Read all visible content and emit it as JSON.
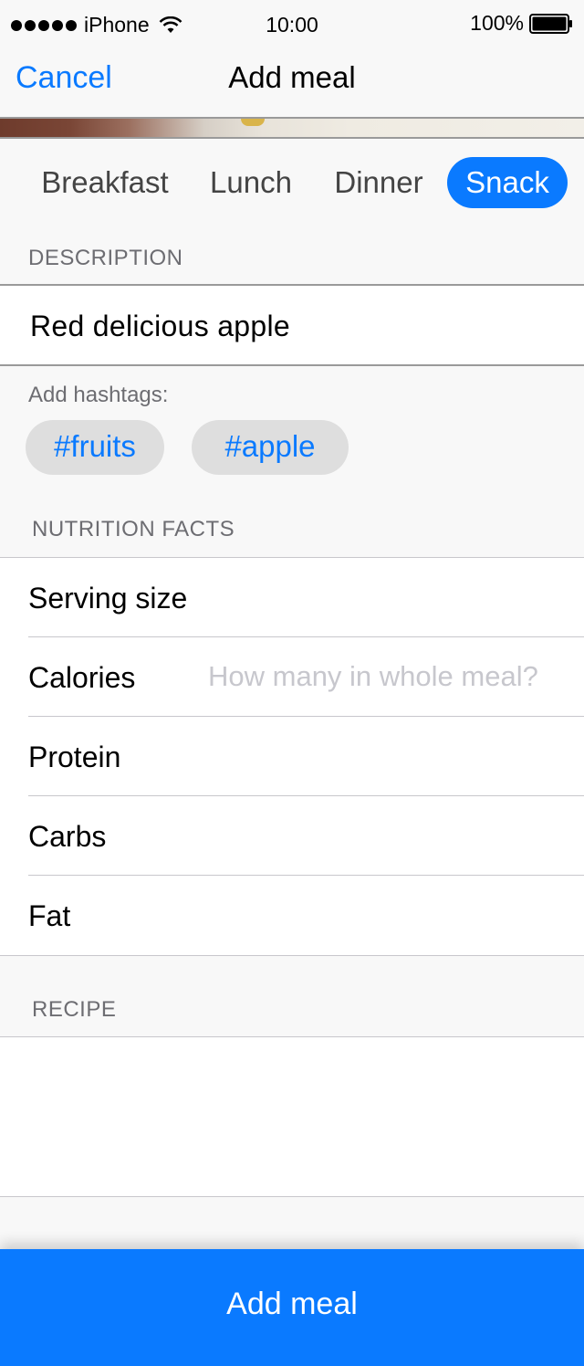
{
  "status_bar": {
    "carrier": "iPhone",
    "time": "10:00",
    "battery": "100%"
  },
  "nav": {
    "cancel_label": "Cancel",
    "title": "Add meal"
  },
  "meal_types": {
    "items": [
      "Breakfast",
      "Lunch",
      "Dinner",
      "Snack"
    ],
    "selected": "Snack"
  },
  "description": {
    "header": "DESCRIPTION",
    "value": "Red delicious apple"
  },
  "hashtags": {
    "label": "Add hashtags:",
    "tags": [
      "#fruits",
      "#apple"
    ]
  },
  "nutrition": {
    "header": "NUTRITION FACTS",
    "rows": [
      {
        "label": "Serving size",
        "value": "",
        "placeholder": ""
      },
      {
        "label": "Calories",
        "value": "",
        "placeholder": "How many in whole meal?"
      },
      {
        "label": "Protein",
        "value": "",
        "placeholder": ""
      },
      {
        "label": "Carbs",
        "value": "",
        "placeholder": ""
      },
      {
        "label": "Fat",
        "value": "",
        "placeholder": ""
      }
    ]
  },
  "recipe": {
    "header": "RECIPE",
    "value": ""
  },
  "footer": {
    "add_meal_label": "Add meal"
  },
  "colors": {
    "accent": "#0a7aff",
    "background": "#f8f8f8",
    "chip": "#dedede"
  }
}
